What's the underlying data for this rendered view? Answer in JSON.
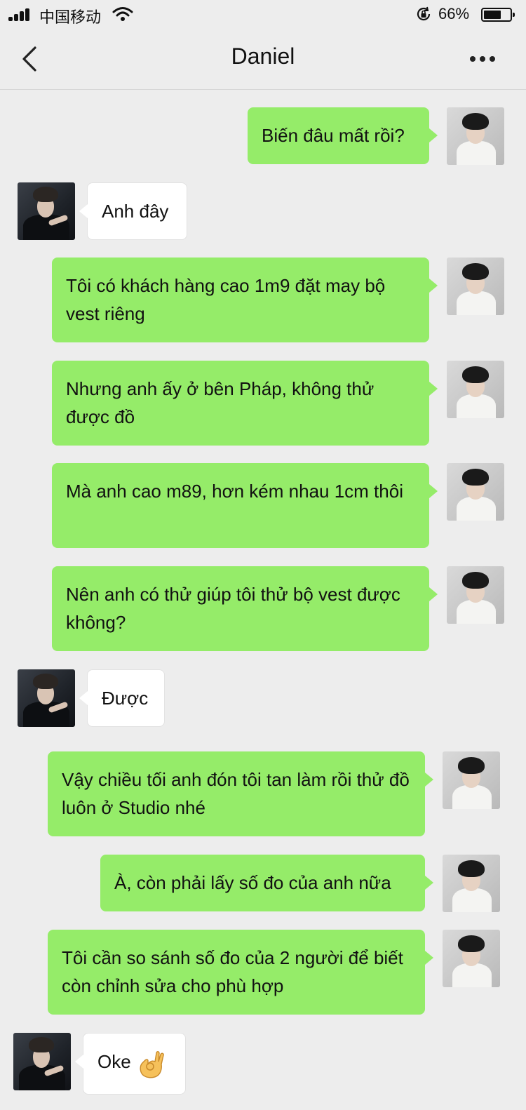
{
  "status": {
    "carrier": "中国移动",
    "battery_pct": "66%",
    "battery_level": 0.66
  },
  "header": {
    "title": "Daniel"
  },
  "colors": {
    "me_bubble": "#95ec69",
    "other_bubble": "#ffffff",
    "background": "#ededed"
  },
  "messages": [
    {
      "from": "me",
      "text": "Biến đâu mất rồi?"
    },
    {
      "from": "other",
      "text": "Anh đây"
    },
    {
      "from": "me",
      "text": "Tôi có khách hàng cao 1m9 đặt may bộ vest riêng"
    },
    {
      "from": "me",
      "text": "Nhưng anh ấy ở bên Pháp, không thử được đồ"
    },
    {
      "from": "me",
      "text": "Mà anh cao m89, hơn kém nhau 1cm thôi"
    },
    {
      "from": "me",
      "text": "Nên anh có thử giúp tôi thử bộ vest được không?"
    },
    {
      "from": "other",
      "text": "Được"
    },
    {
      "from": "me",
      "text": "Vậy chiều tối anh đón tôi tan làm rồi thử đồ luôn ở Studio nhé"
    },
    {
      "from": "me",
      "text": "À, còn phải lấy số đo của anh nữa"
    },
    {
      "from": "me",
      "text": "Tôi cần so sánh số đo của 2 người để biết còn chỉnh sửa cho phù hợp"
    },
    {
      "from": "other",
      "text": "Oke",
      "emoji": "ok-hand-icon"
    }
  ]
}
